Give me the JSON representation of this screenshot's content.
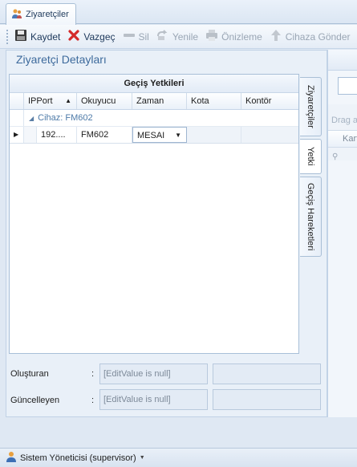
{
  "document_tab": {
    "label": "Ziyaretçiler"
  },
  "toolbar": {
    "save": "Kaydet",
    "cancel": "Vazgeç",
    "delete": "Sil",
    "refresh": "Yenile",
    "preview": "Önizleme",
    "send_device": "Cihaza Gönder"
  },
  "panel": {
    "title": "Ziyaretçi Detayları"
  },
  "grid": {
    "caption": "Geçiş Yetkileri",
    "columns": [
      "IPPort",
      "Okuyucu",
      "Zaman",
      "Kota",
      "Kontör"
    ],
    "group_label": "Cihaz: FM602",
    "rows": [
      {
        "ipport": "192....",
        "okuyucu": "FM602",
        "zaman": "MESAI",
        "kota": "",
        "kontor": ""
      }
    ]
  },
  "side_tabs": [
    "Ziyaretçiler",
    "Yetki",
    "Geçiş Hareketleri"
  ],
  "form": {
    "created_label": "Oluşturan",
    "created_value": "[EditValue is null]",
    "updated_label": "Güncelleyen",
    "updated_value": "[EditValue is null]",
    "colon": ":"
  },
  "right_panel": {
    "drag_hint": "Drag a",
    "column_fragment": "Kart"
  },
  "statusbar": {
    "user": "Sistem Yöneticisi (supervisor)"
  }
}
